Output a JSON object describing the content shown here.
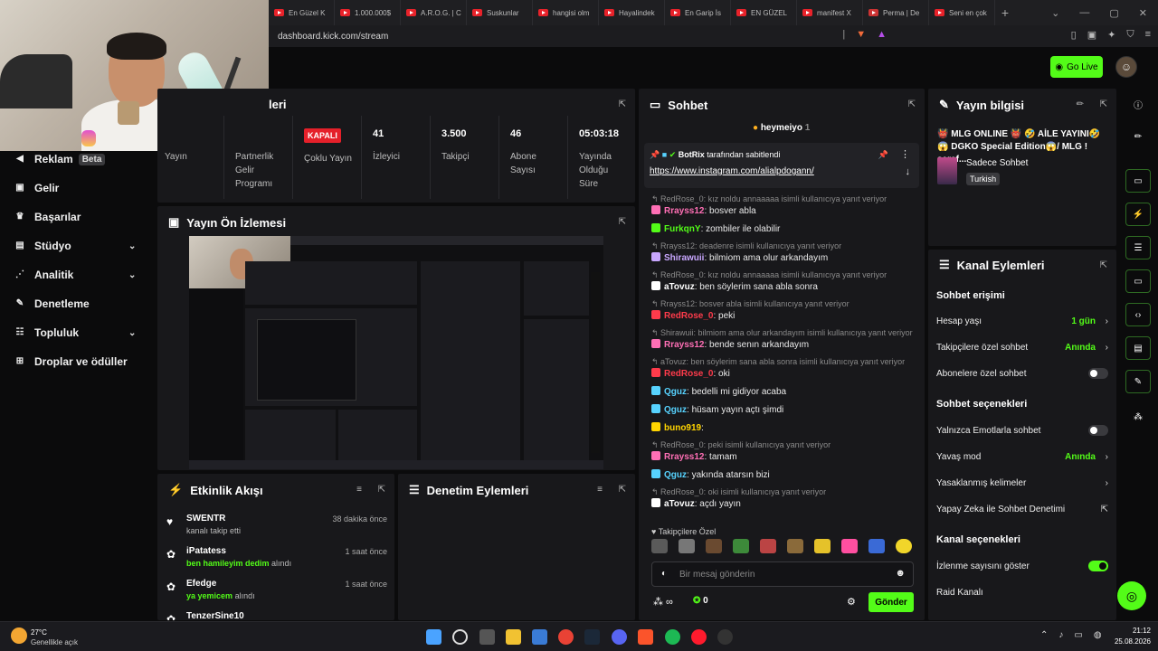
{
  "browser": {
    "tabs": [
      "En Güzel K",
      "1.000.000$",
      "A.R.O.G. | C",
      "Suskunlar",
      "hangisi olm",
      "Hayalindek",
      "En Garip İs",
      "EN GÜZEL",
      "manifest X",
      "Perma | De",
      "Seni en çok"
    ],
    "url": "dashboard.kick.com/stream"
  },
  "header": {
    "go_live": "Go Live"
  },
  "sidebar": {
    "items": [
      {
        "label": "Reklam",
        "badge": "Beta",
        "icon": "megaphone-icon"
      },
      {
        "label": "Gelir",
        "icon": "wallet-icon"
      },
      {
        "label": "Başarılar",
        "icon": "trophy-icon"
      },
      {
        "label": "Stüdyo",
        "icon": "studio-icon"
      },
      {
        "label": "Analitik",
        "icon": "analytics-icon"
      },
      {
        "label": "Denetleme",
        "icon": "wrench-icon"
      },
      {
        "label": "Topluluk",
        "icon": "community-icon"
      },
      {
        "label": "Droplar ve ödüller",
        "icon": "gift-icon"
      }
    ]
  },
  "stats": {
    "title_fragment": "leri",
    "cells": [
      {
        "value": "",
        "label": "Yayın"
      },
      {
        "value": "",
        "label": "Partnerlik Gelir Programı"
      },
      {
        "value": "KAPALI",
        "label": "Çoklu Yayın"
      },
      {
        "value": "41",
        "label": "İzleyici"
      },
      {
        "value": "3.500",
        "label": "Takipçi"
      },
      {
        "value": "46",
        "label": "Abone Sayısı"
      },
      {
        "value": "05:03:18",
        "label": "Yayında Olduğu Süre"
      }
    ]
  },
  "preview": {
    "title": "Yayın Ön İzlemesi"
  },
  "activity": {
    "title": "Etkinlik Akışı",
    "items": [
      {
        "name": "SWENTR",
        "time": "38 dakika önce",
        "desc": "kanalı takip etti",
        "gift": "",
        "suffix": "",
        "icon": "heart-icon"
      },
      {
        "name": "iPatatess",
        "time": "1 saat önce",
        "desc": "",
        "gift": "ben hamileyim dedim",
        "suffix": "alındı",
        "icon": "redeem-icon"
      },
      {
        "name": "Efedge",
        "time": "1 saat önce",
        "desc": "",
        "gift": "ya yemicem",
        "suffix": "alındı",
        "icon": "redeem-icon"
      },
      {
        "name": "TenzerSine10",
        "time": "",
        "desc": "",
        "gift": "",
        "suffix": "",
        "icon": "redeem-icon"
      }
    ]
  },
  "moderation": {
    "title": "Denetim Eylemleri"
  },
  "chat": {
    "title": "Sohbet",
    "top_user": "heymeiyo",
    "top_count": "1",
    "pinned_by": "BotRix",
    "pinned_label": "tarafından sabitlendi",
    "pinned_link": "https://www.instagram.com/alialpdogann/",
    "messages": [
      {
        "reply": "RedRose_0: kız noldu annaaaaa isimli kullanıcıya yanıt veriyor",
        "user": "Rrayss12",
        "color": "#ff6fb5",
        "text": "bosver abla"
      },
      {
        "reply": "",
        "user": "FurkqnY",
        "color": "#53fc18",
        "text": "zombiler ile olabilir"
      },
      {
        "reply": "Rrayss12: deadenre isimli kullanıcıya yanıt veriyor",
        "user": "Shirawuii",
        "color": "#c9a7ff",
        "text": "bilmiom ama olur arkandayım"
      },
      {
        "reply": "RedRose_0: kız noldu annaaaaa isimli kullanıcıya yanıt veriyor",
        "user": "aTovuz",
        "color": "#ffffff",
        "text": "ben söylerim sana abla sonra"
      },
      {
        "reply": "Rrayss12: bosver abla isimli kullanıcıya yanıt veriyor",
        "user": "RedRose_0",
        "color": "#ff3b4b",
        "text": "peki"
      },
      {
        "reply": "Shirawuii: bilmiom ama olur arkandayım isimli kullanıcıya yanıt veriyor",
        "user": "Rrayss12",
        "color": "#ff6fb5",
        "text": "bende senın arkandayım"
      },
      {
        "reply": "aTovuz: ben söylerim sana abla sonra isimli kullanıcıya yanıt veriyor",
        "user": "RedRose_0",
        "color": "#ff3b4b",
        "text": "oki"
      },
      {
        "reply": "",
        "user": "Qguz",
        "color": "#57d3ff",
        "text": "bedelli mi gidiyor acaba"
      },
      {
        "reply": "",
        "user": "Qguz",
        "color": "#57d3ff",
        "text": "hüsam yayın açtı şimdi"
      },
      {
        "reply": "",
        "user": "buno919",
        "color": "#ffd400",
        "text": ""
      },
      {
        "reply": "RedRose_0: peki isimli kullanıcıya yanıt veriyor",
        "user": "Rrayss12",
        "color": "#ff6fb5",
        "text": "tamam"
      },
      {
        "reply": "",
        "user": "Qguz",
        "color": "#57d3ff",
        "text": "yakında atarsın bizi"
      },
      {
        "reply": "RedRose_0: oki isimli kullanıcıya yanıt veriyor",
        "user": "aTovuz",
        "color": "#ffffff",
        "text": "açdı yayın"
      }
    ],
    "followers_only": "Takipçilere Özel",
    "input_placeholder": "Bir mesaj gönderin",
    "points": "0",
    "send": "Gönder"
  },
  "stream_info": {
    "title": "Yayın bilgisi",
    "stream_title": "👹 MLG ONLINE 👹 🤣 AİLE YAYINI🤣 😱 DGKO Special Edition😱/ MLG !şeref...",
    "category": "Sadece Sohbet",
    "language": "Turkish"
  },
  "channel_actions": {
    "title": "Kanal Eylemleri",
    "chat_access": "Sohbet erişimi",
    "account_age": "Hesap yaşı",
    "account_age_value": "1 gün",
    "followers_chat": "Takipçilere özel sohbet",
    "followers_chat_value": "Anında",
    "subs_chat": "Abonelere özel sohbet",
    "chat_options": "Sohbet seçenekleri",
    "emote_only": "Yalnızca Emotlarla sohbet",
    "slow_mode": "Yavaş mod",
    "slow_mode_value": "Anında",
    "banned_words": "Yasaklanmış kelimeler",
    "ai_moderation": "Yapay Zeka ile Sohbet Denetimi",
    "channel_options": "Kanal seçenekleri",
    "show_viewers": "İzlenme sayısını göster",
    "raid": "Raid Kanalı"
  },
  "taskbar": {
    "weather_temp": "27°C",
    "weather_desc": "Genellikle açık",
    "time": "21:12",
    "date": "25.08.2026"
  },
  "colors": {
    "kick_green": "#53fc18",
    "panel": "#18181b",
    "red_badge": "#e5202a"
  }
}
